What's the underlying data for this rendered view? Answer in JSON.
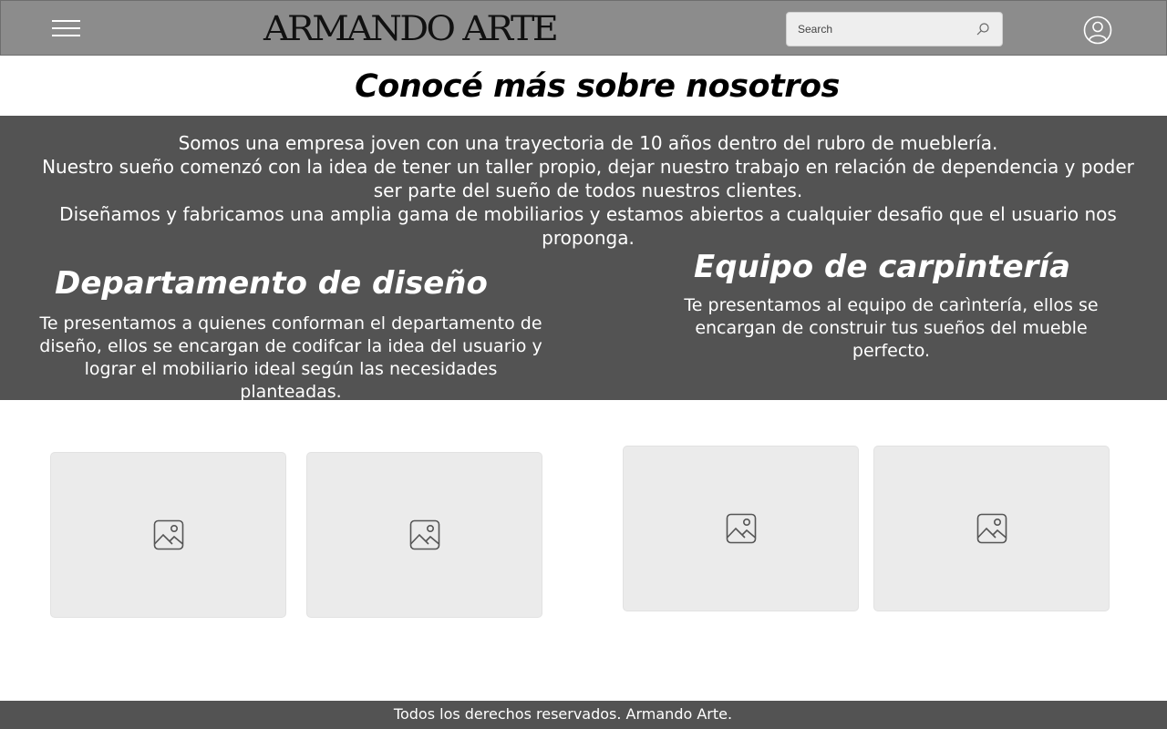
{
  "header": {
    "brand": "ARMANDO ARTE",
    "search_placeholder": "Search",
    "icons": {
      "menu": "hamburger-menu-icon",
      "search": "search-icon",
      "account": "user-account-icon"
    },
    "background_color": "#8c8c8c"
  },
  "main": {
    "title": "Conocé más sobre nosotros",
    "intro": [
      "Somos una empresa joven con una trayectoria de 10 años dentro del rubro de mueblería.",
      "Nuestro sueño comenzó con la idea de tener un taller propio, dejar nuestro trabajo en relación de dependencia y poder ser parte del sueño de todos nuestros clientes.",
      "Diseñamos y fabricamos una amplia gama de mobiliarios y estamos abiertos a cualquier desafio que el usuario nos proponga."
    ],
    "band_color": "#535353",
    "sections": [
      {
        "title": "Departamento de diseño",
        "text": "Te presentamos a quienes conforman el departamento de diseño, ellos se encargan de codifcar la idea del usuario y lograr el mobiliario ideal según las necesidades planteadas."
      },
      {
        "title": "Equipo de carpintería",
        "text": "Te presentamos al equipo de carìntería, ellos se encargan de construir tus sueños del mueble perfecto."
      }
    ],
    "image_placeholders": [
      "image-icon",
      "image-icon",
      "image-icon",
      "image-icon"
    ]
  },
  "footer": {
    "text": "Todos los derechos reservados. Armando Arte.",
    "background_color": "#535353"
  }
}
